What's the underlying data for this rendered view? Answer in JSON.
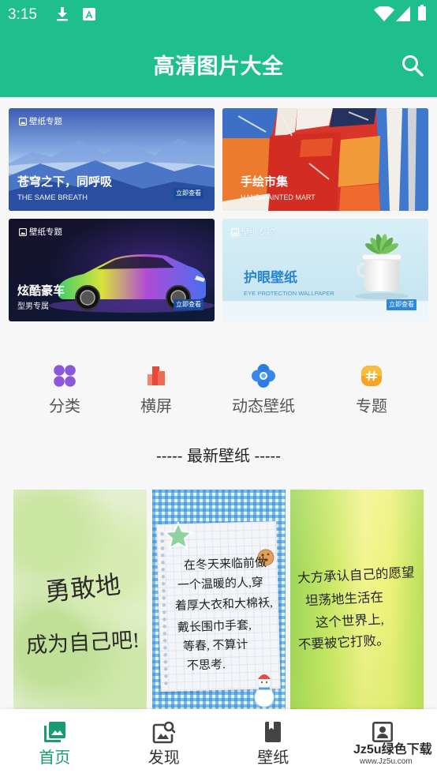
{
  "status_bar": {
    "time": "3:15"
  },
  "header": {
    "title": "高清图片大全",
    "search_icon": "search-icon"
  },
  "colors": {
    "primary": "#1fbe8d",
    "nav_active": "#189a74",
    "nav_inactive": "#444444",
    "eye_blue": "#2a83d4"
  },
  "banners": [
    {
      "tag": "壁纸专题",
      "title": "苍穹之下，同呼吸",
      "subtitle": "THE SAME BREATH",
      "button": "立即查看"
    },
    {
      "title": "手绘市集",
      "subtitle": "HAND-PAINTED MART"
    },
    {
      "tag": "壁纸专题",
      "title": "炫酷豪车",
      "subtitle": "型男专属",
      "button": "立即查看"
    },
    {
      "tag": "壁纸专题",
      "title": "护眼壁纸",
      "subtitle": "EYE PROTECTION WALLPAPER",
      "button": "立即查看"
    }
  ],
  "categories": [
    {
      "label": "分类",
      "icon": "category-grid-icon"
    },
    {
      "label": "横屏",
      "icon": "landscape-chart-icon"
    },
    {
      "label": "动态壁纸",
      "icon": "live-wallpaper-icon"
    },
    {
      "label": "专题",
      "icon": "topic-hashtag-icon"
    }
  ],
  "latest": {
    "title": "----- 最新壁纸 -----",
    "wallpapers": [
      {
        "lines": [
          "勇敢地",
          "成为自己吧!"
        ]
      },
      {
        "lines": [
          "在冬天来临前做",
          "一个温暖的人,穿",
          "着厚大衣和大棉袄,",
          "戴长围巾手套,",
          "等春, 不算计",
          "不思考."
        ]
      },
      {
        "lines": [
          "大方承认自己的愿望",
          "坦荡地生活在",
          "这个世界上,",
          "不要被它打败。"
        ]
      }
    ]
  },
  "bottom_nav": {
    "items": [
      {
        "label": "首页",
        "icon": "photo-library-icon",
        "selected": true
      },
      {
        "label": "发现",
        "icon": "image-search-icon",
        "selected": false
      },
      {
        "label": "壁纸",
        "icon": "bookmark-icon",
        "selected": false
      },
      {
        "icon": "account-box-icon",
        "selected": false
      }
    ]
  },
  "watermark": {
    "brand": "Jz5u绿色下载",
    "url": "www.Jz5u.com"
  }
}
